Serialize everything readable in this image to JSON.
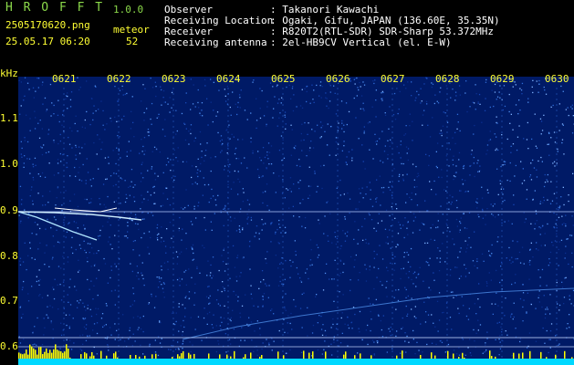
{
  "header": {
    "app_title": "H R O F F T",
    "version": "1.0.0",
    "filename": "2505170620.png",
    "timestamp": "25.05.17 06:20",
    "count_label": "meteor",
    "count_value": "52"
  },
  "info": {
    "labels": [
      "Observer",
      "Receiving Location",
      "Receiver",
      "Receiving antenna"
    ],
    "values": [
      ": Takanori Kawachi",
      ": Ogaki, Gifu, JAPAN (136.60E, 35.35N)",
      ": R820T2(RTL-SDR) SDR-Sharp 53.372MHz",
      ": 2el-HB9CV Vertical (el. E-W)"
    ]
  },
  "axis": {
    "unit": "kHz",
    "time_ticks": [
      "0621",
      "0622",
      "0623",
      "0624",
      "0625",
      "0626",
      "0627",
      "0628",
      "0629",
      "0630"
    ],
    "freq_ticks": [
      "1.1",
      "1.0",
      "0.9",
      "0.8",
      "0.7",
      "0.6"
    ]
  },
  "colors": {
    "background": "#000000",
    "noise_dark": "#001a66",
    "noise_bright": "#2e6bd6",
    "text_green": "#8bd84a",
    "text_yellow": "#ffff33",
    "signal_bar": "#ffff00",
    "baseline": "#00ffff"
  }
}
